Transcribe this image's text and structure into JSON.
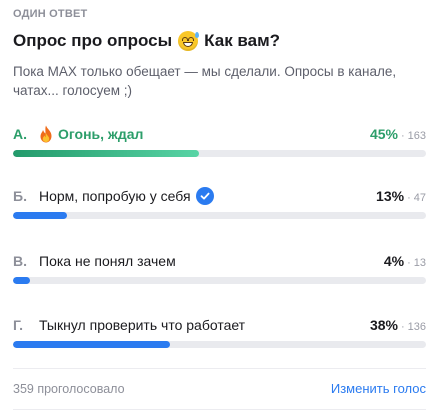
{
  "poll": {
    "kind": "ОДИН ОТВЕТ",
    "title_part1": "Опрос про опросы",
    "title_part2": "Как вам?",
    "title_emoji": "grinning-sweat-emoji",
    "subtitle": "Пока MAX только обещает — мы сделали. Опросы в канале, чатах... голосуем ;)",
    "options": [
      {
        "letter": "А.",
        "label": "Огонь, ждал",
        "icon": "fire-icon",
        "percent_text": "45%",
        "separator": "·",
        "count": "163",
        "percent": 45,
        "winner": true,
        "voted": false
      },
      {
        "letter": "Б.",
        "label": "Норм, попробую у себя",
        "icon": "check-circle-icon",
        "percent_text": "13%",
        "separator": "·",
        "count": "47",
        "percent": 13,
        "winner": false,
        "voted": true
      },
      {
        "letter": "В.",
        "label": "Пока не понял зачем",
        "percent_text": "4%",
        "separator": "·",
        "count": "13",
        "percent": 4,
        "winner": false,
        "voted": false
      },
      {
        "letter": "Г.",
        "label": "Тыкнул проверить что работает",
        "percent_text": "38%",
        "separator": "·",
        "count": "136",
        "percent": 38,
        "winner": false,
        "voted": false
      }
    ],
    "total_votes": "359 проголосовало",
    "change_vote": "Изменить голос"
  },
  "colors": {
    "winner": "#2c9e6a",
    "accent": "#2b7bf0",
    "track": "#e9eaee",
    "muted": "#8d8f99"
  }
}
